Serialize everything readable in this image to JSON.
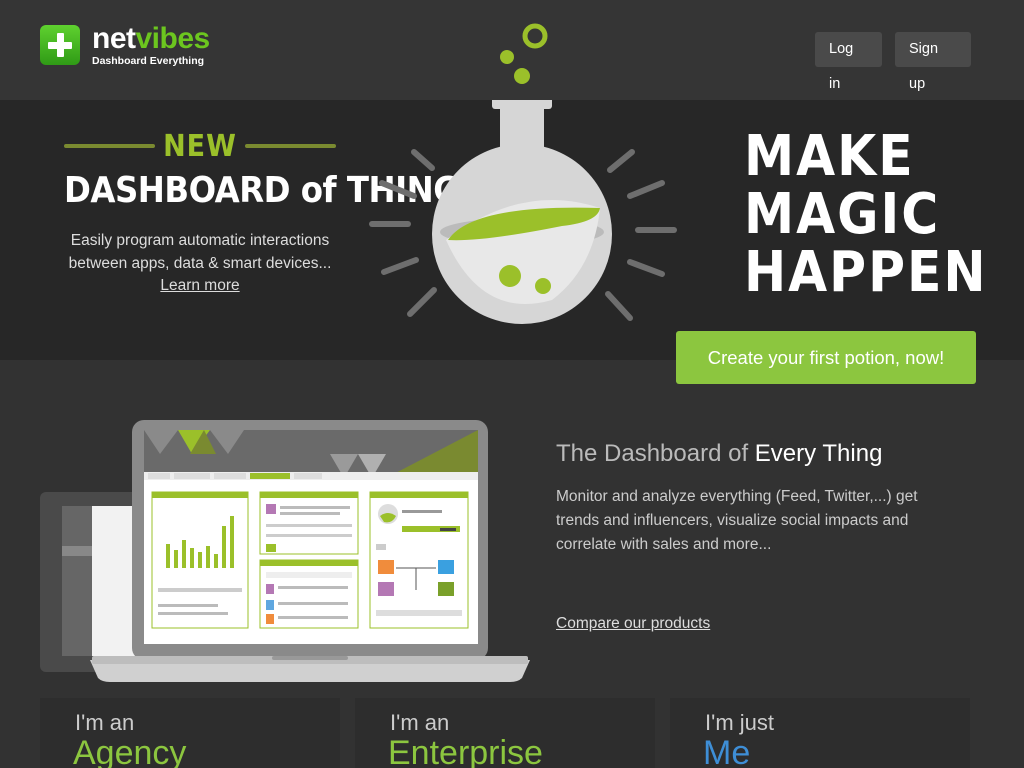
{
  "header": {
    "logo_name_part1": "net",
    "logo_name_part2": "vibes",
    "logo_tagline": "Dashboard Everything",
    "login_label": "Log in",
    "signup_label": "Sign up"
  },
  "hero": {
    "new_label": "NEW",
    "title": "DASHBOARD of THINGS",
    "description": "Easily program automatic interactions between apps, data & smart devices...",
    "learn_more": "Learn more",
    "tagline_1": "MAKE",
    "tagline_2": "MAGIC",
    "tagline_3": "HAPPEN",
    "cta_label": "Create your first potion, now!"
  },
  "product": {
    "title_part1": "The Dashboard of ",
    "title_part2": "Every Thing",
    "description": "Monitor and analyze everything (Feed, Twitter,...) get trends and influencers, visualize social impacts and correlate with sales and more...",
    "compare_link": "Compare our products"
  },
  "cards": [
    {
      "pre": "I'm an",
      "main": "Agency"
    },
    {
      "pre": "I'm an",
      "main": "Enterprise"
    },
    {
      "pre": "I'm just",
      "main": "Me"
    }
  ],
  "colors": {
    "brand_green": "#8cc63f",
    "logo_green": "#6cc61f",
    "me_blue": "#3e8ed6",
    "background": "#323232",
    "hero_background": "#272727"
  },
  "icons": [
    "plus-logo-icon",
    "flask-icon",
    "laptop-dashboard-illustration"
  ]
}
